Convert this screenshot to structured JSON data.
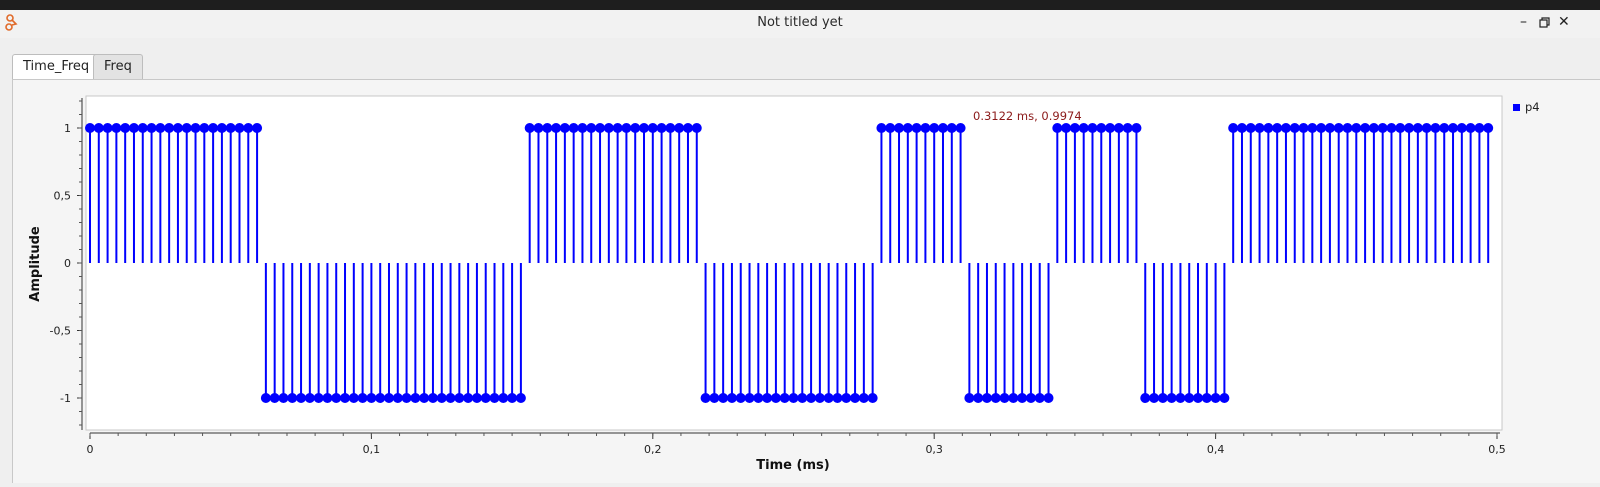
{
  "window": {
    "title": "Not titled yet",
    "icon": "gnuradio-icon",
    "controls": [
      "minimize-icon",
      "restore-icon",
      "close-icon"
    ]
  },
  "tabs": [
    {
      "label": "Time_Freq",
      "active": true
    },
    {
      "label": "Freq",
      "active": false
    }
  ],
  "plot": {
    "ylabel": "Amplitude",
    "xlabel": "Time (ms)",
    "legend": [
      "p4"
    ],
    "marker_readout": "0.3122 ms, 0.9974",
    "series_color": "#0000ff",
    "readout_color": "#8b1a1a"
  },
  "chart_data": {
    "type": "stem",
    "series": [
      {
        "name": "p4"
      }
    ],
    "x_unit": "ms",
    "xlim": [
      0,
      0.5
    ],
    "ylim": [
      -1.25,
      1.25
    ],
    "x_ticks": [
      "0",
      "0,1",
      "0,2",
      "0,3",
      "0,4",
      "0,5"
    ],
    "y_ticks": [
      "1",
      "0,5",
      "0",
      "-0,5",
      "-1"
    ],
    "sample_spacing_ms": 0.003125,
    "segments": [
      {
        "level": 1,
        "count": 20
      },
      {
        "level": -1,
        "count": 30
      },
      {
        "level": 1,
        "count": 20
      },
      {
        "level": -1,
        "count": 20
      },
      {
        "level": 1,
        "count": 10
      },
      {
        "level": -1,
        "count": 10
      },
      {
        "level": 1,
        "count": 10
      },
      {
        "level": -1,
        "count": 10
      },
      {
        "level": 1,
        "count": 30
      }
    ],
    "grid": false,
    "legend_position": "top-right"
  }
}
